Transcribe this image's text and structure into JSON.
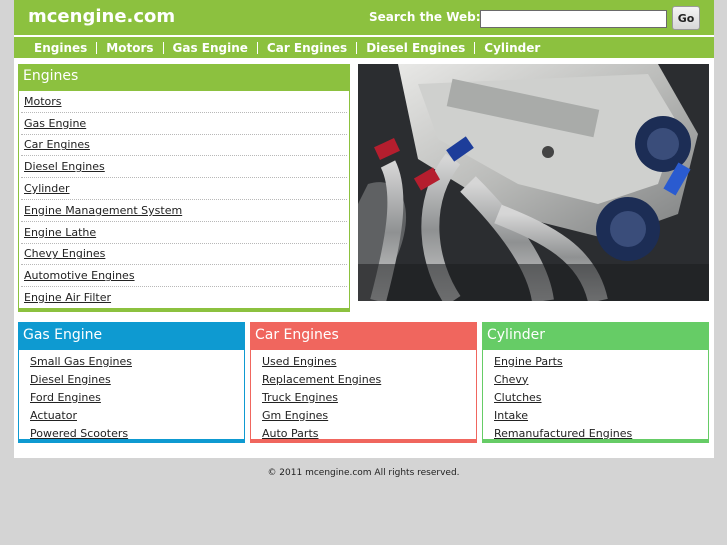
{
  "site": {
    "logo": "mcengine.com",
    "search_label": "Search the Web:",
    "search_value": "",
    "search_button": "Go"
  },
  "nav": [
    "Engines",
    "Motors",
    "Gas Engine",
    "Car Engines",
    "Diesel Engines",
    "Cylinder"
  ],
  "main_box": {
    "title": "Engines",
    "links": [
      "Motors",
      "Gas Engine",
      "Car Engines",
      "Diesel Engines",
      "Cylinder",
      "Engine Management System",
      "Engine Lathe",
      "Chevy Engines",
      "Automotive Engines",
      "Engine Air Filter"
    ],
    "color": "#8cc13f"
  },
  "columns": [
    {
      "title": "Gas Engine",
      "color": "#0e9ad1",
      "links": [
        "Small Gas Engines",
        "Diesel Engines",
        "Ford Engines",
        "Actuator",
        "Powered Scooters"
      ]
    },
    {
      "title": "Car Engines",
      "color": "#f0665e",
      "links": [
        "Used Engines",
        "Replacement Engines",
        "Truck Engines",
        "Gm Engines",
        "Auto Parts"
      ]
    },
    {
      "title": "Cylinder",
      "color": "#66cc66",
      "links": [
        "Engine Parts",
        "Chevy",
        "Clutches",
        "Intake",
        "Remanufactured Engines"
      ]
    }
  ],
  "footer": "© 2011 mcengine.com All rights reserved.",
  "colors": {
    "header": "#8cc13f",
    "page_bg": "#d4d4d4"
  }
}
